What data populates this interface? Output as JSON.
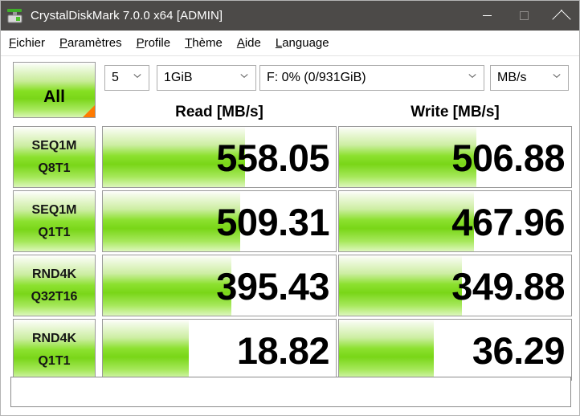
{
  "window": {
    "title": "CrystalDiskMark 7.0.0 x64 [ADMIN]",
    "icon": "disk-drive-icon",
    "controls": {
      "minimize": "minimize-icon",
      "maximize": "maximize-icon",
      "close": "close-icon"
    },
    "titlebar_color": "#4c4a48"
  },
  "menu": {
    "items": [
      {
        "accel": "F",
        "rest": "ichier"
      },
      {
        "accel": "P",
        "rest": "aramètres"
      },
      {
        "accel": "P",
        "rest": "rofile"
      },
      {
        "accel": "T",
        "rest": "hème"
      },
      {
        "accel": "A",
        "rest": "ide"
      },
      {
        "accel": "L",
        "rest": "anguage"
      }
    ]
  },
  "toolbar": {
    "all_button_label": "All",
    "run_count": "5",
    "test_size": "1GiB",
    "drive": "F: 0% (0/931GiB)",
    "unit": "MB/s"
  },
  "columns": {
    "read": "Read [MB/s]",
    "write": "Write [MB/s]"
  },
  "chart_data": {
    "type": "bar",
    "title": "CrystalDiskMark 7.0.0 x64 Benchmark Results",
    "xlabel": "",
    "ylabel": "MB/s",
    "unit": "MB/s",
    "categories": [
      "SEQ1M Q8T1",
      "SEQ1M Q1T1",
      "RND4K Q32T16",
      "RND4K Q1T1"
    ],
    "series": [
      {
        "name": "Read [MB/s]",
        "values": [
          558.05,
          509.31,
          395.43,
          18.82
        ]
      },
      {
        "name": "Write [MB/s]",
        "values": [
          506.88,
          467.96,
          349.88,
          36.29
        ]
      }
    ],
    "bar_fill_percent": {
      "read": [
        61,
        59,
        55,
        37
      ],
      "write": [
        59,
        58,
        53,
        41
      ]
    },
    "legend_position": "top",
    "grid": false,
    "accent_color": "#7ad619"
  },
  "rows": [
    {
      "test": "SEQ1M",
      "queue": "Q8T1",
      "read": {
        "value": "558.05",
        "fill": 61
      },
      "write": {
        "value": "506.88",
        "fill": 59
      }
    },
    {
      "test": "SEQ1M",
      "queue": "Q1T1",
      "read": {
        "value": "509.31",
        "fill": 59
      },
      "write": {
        "value": "467.96",
        "fill": 58
      }
    },
    {
      "test": "RND4K",
      "queue": "Q32T16",
      "read": {
        "value": "395.43",
        "fill": 55
      },
      "write": {
        "value": "349.88",
        "fill": 53
      }
    },
    {
      "test": "RND4K",
      "queue": "Q1T1",
      "read": {
        "value": "18.82",
        "fill": 37
      },
      "write": {
        "value": "36.29",
        "fill": 41
      }
    }
  ],
  "status": {
    "text": ""
  }
}
